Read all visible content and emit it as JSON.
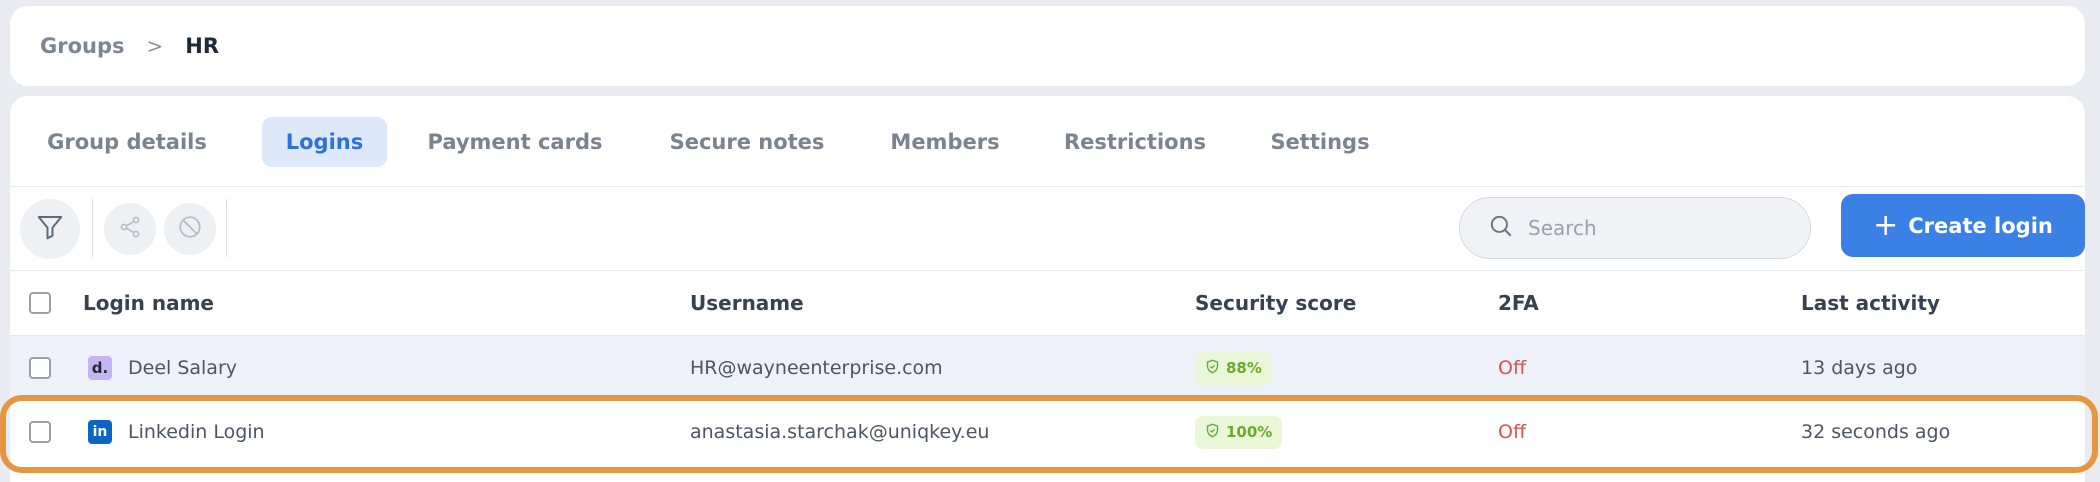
{
  "breadcrumb": {
    "parent": "Groups",
    "separator": ">",
    "current": "HR"
  },
  "tabs": [
    {
      "label": "Group details",
      "active": false
    },
    {
      "label": "Logins",
      "active": true
    },
    {
      "label": "Payment cards",
      "active": false
    },
    {
      "label": "Secure notes",
      "active": false
    },
    {
      "label": "Members",
      "active": false
    },
    {
      "label": "Restrictions",
      "active": false
    },
    {
      "label": "Settings",
      "active": false
    }
  ],
  "toolbar": {
    "filter_icon": "filter-icon",
    "share_icon": "share-icon",
    "block_icon": "block-icon",
    "search_placeholder": "Search",
    "search_value": "",
    "create_label": "Create login",
    "create_color": "#3a80e5"
  },
  "table": {
    "columns": [
      "Login name",
      "Username",
      "Security score",
      "2FA",
      "Last activity"
    ],
    "rows": [
      {
        "icon": "d.",
        "login_name": "Deel Salary",
        "username": "HR@wayneenterprise.com",
        "security_score": "88%",
        "twofa": "Off",
        "last_activity": "13 days ago"
      },
      {
        "icon": "in",
        "login_name": "Linkedin Login",
        "username": "anastasia.starchak@uniqkey.eu",
        "security_score": "100%",
        "twofa": "Off",
        "last_activity": "32 seconds ago"
      }
    ]
  },
  "colors": {
    "accent": "#3a80e5",
    "highlight": "#e6963f",
    "off": "#d9534f",
    "score": "#6aab2e"
  }
}
